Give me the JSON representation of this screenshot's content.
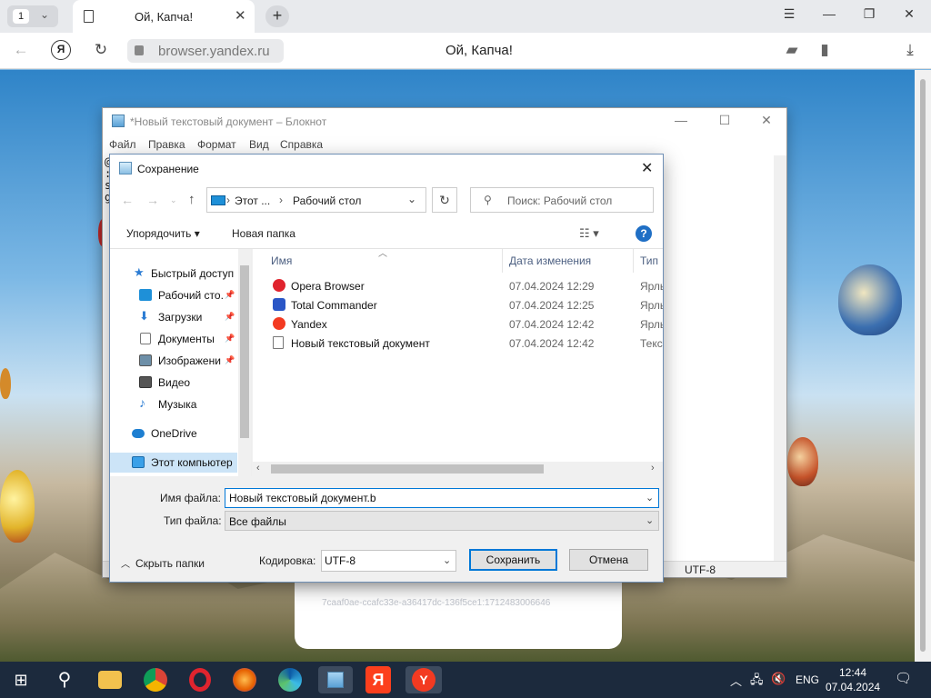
{
  "browser": {
    "tab_count": "1",
    "tab_title": "Ой, Капча!",
    "url": "browser.yandex.ru",
    "page_title": "Ой, Капча!"
  },
  "captcha": {
    "hash": "7caaf0ae-ccafc33e-a36417dc-136f5ce1:1712483006646"
  },
  "notepad": {
    "title": "*Новый текстовый документ – Блокнот",
    "menu": [
      "Файл",
      "Правка",
      "Формат",
      "Вид",
      "Справка"
    ],
    "lines": [
      "@",
      ":",
      "s",
      "g"
    ],
    "encoding": "UTF-8"
  },
  "dialog": {
    "title": "Сохранение",
    "breadcrumb": [
      "Этот ...",
      "Рабочий стол"
    ],
    "search_placeholder": "Поиск: Рабочий стол",
    "organize": "Упорядочить",
    "new_folder": "Новая папка",
    "help": "?",
    "nav": [
      {
        "label": "Быстрый доступ",
        "icon": "star-icon",
        "pinned": false
      },
      {
        "label": "Рабочий сто.",
        "icon": "desktop-icon",
        "pinned": true
      },
      {
        "label": "Загрузки",
        "icon": "download-icon",
        "pinned": true
      },
      {
        "label": "Документы",
        "icon": "documents-icon",
        "pinned": true
      },
      {
        "label": "Изображени",
        "icon": "pictures-icon",
        "pinned": true
      },
      {
        "label": "Видео",
        "icon": "video-icon",
        "pinned": false
      },
      {
        "label": "Музыка",
        "icon": "music-icon",
        "pinned": false
      },
      {
        "label": "OneDrive",
        "icon": "cloud-icon",
        "pinned": false
      },
      {
        "label": "Этот компьютер",
        "icon": "computer-icon",
        "pinned": false
      }
    ],
    "columns": [
      "Имя",
      "Дата изменения",
      "Тип"
    ],
    "files": [
      {
        "name": "Opera Browser",
        "date": "07.04.2024 12:29",
        "type": "Ярлык",
        "icon": "opera-icon",
        "color": "#e0242e"
      },
      {
        "name": "Total Commander",
        "date": "07.04.2024 12:25",
        "type": "Ярлык",
        "icon": "floppy-icon",
        "color": "#2a56c6"
      },
      {
        "name": "Yandex",
        "date": "07.04.2024 12:42",
        "type": "Ярлык",
        "icon": "yandex-icon",
        "color": "#f33a21"
      },
      {
        "name": "Новый текстовый документ",
        "date": "07.04.2024 12:42",
        "type": "Текстовый",
        "icon": "text-file-icon",
        "color": "#ffffff"
      }
    ],
    "filename_label": "Имя файла:",
    "filename_value": "Новый текстовый документ.b",
    "filetype_label": "Тип файла:",
    "filetype_value": "Все файлы",
    "hide_folders": "Скрыть папки",
    "encoding_label": "Кодировка:",
    "encoding_value": "UTF-8",
    "save": "Сохранить",
    "cancel": "Отмена"
  },
  "taskbar": {
    "apps": [
      "windows-start-icon",
      "search-icon",
      "file-explorer-icon",
      "chrome-icon",
      "opera-icon",
      "firefox-icon",
      "edge-icon",
      "notepad-icon",
      "yandex-browser-icon",
      "yandex-icon"
    ],
    "lang": "ENG",
    "time": "12:44",
    "date": "07.04.2024"
  },
  "colors": {
    "accent": "#0078d7",
    "taskbar": "#1c2a3d"
  }
}
